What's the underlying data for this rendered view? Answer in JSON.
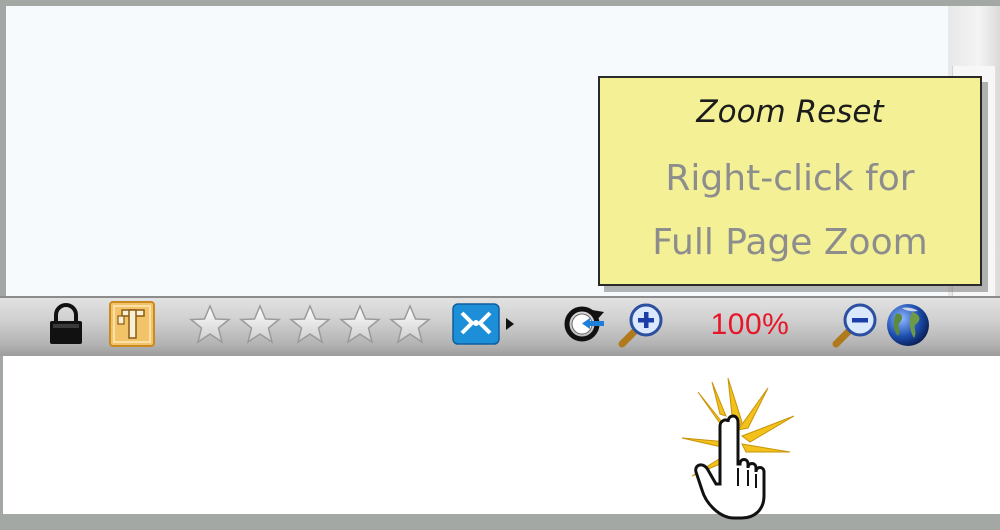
{
  "tooltip": {
    "title": "Zoom Reset",
    "line1": "Right-click for",
    "line2": "Full Page Zoom"
  },
  "statusbar": {
    "zoom_level": "100%",
    "rating": 0,
    "rating_max": 5,
    "icons": [
      "lock-icon",
      "tag-icon",
      "star-icon",
      "split-browser-icon",
      "zoom-reset-icon",
      "zoom-in-icon",
      "zoom-out-icon",
      "globe-icon"
    ]
  },
  "colors": {
    "zoom_level_text": "#e8162a",
    "tooltip_bg": "#f4f096",
    "tooltip_secondary_text": "#8d8d8d",
    "statusbar_bg": "#c4c4c4"
  },
  "cursor": "hand-click-cursor"
}
